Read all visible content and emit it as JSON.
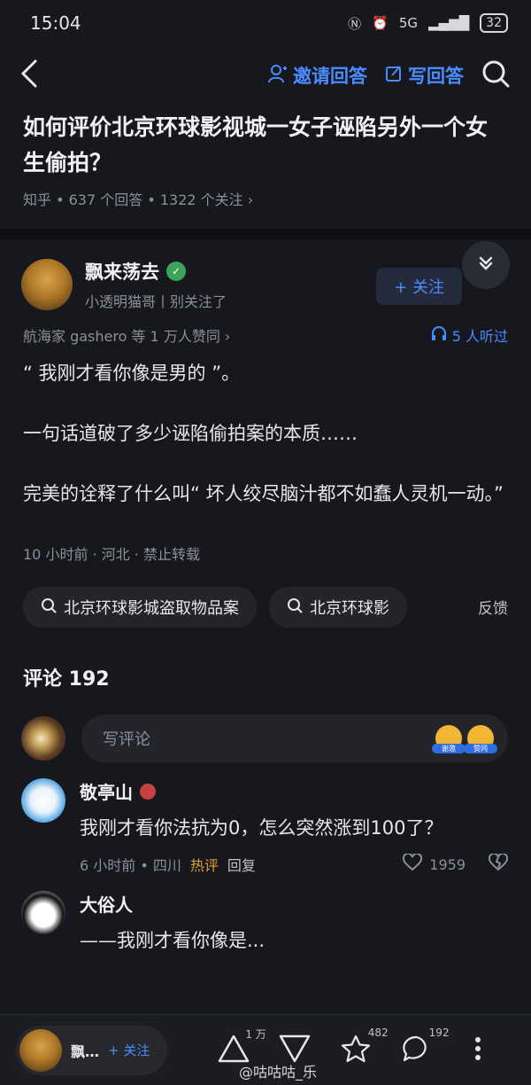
{
  "status_bar": {
    "time": "15:04",
    "network": "5G",
    "battery": "32"
  },
  "nav": {
    "invite": "邀请回答",
    "write": "写回答"
  },
  "question": {
    "title": "如何评价北京环球影视城一女子诬陷另外一个女生偷拍？",
    "meta": "知乎 • 637 个回答 • 1322 个关注 ›"
  },
  "author": {
    "name": "飘来荡去",
    "bio": "小透明猫哥丨别关注了",
    "follow_label": "+ 关注"
  },
  "upvotes": {
    "text": "航海家 gashero 等 1 万人赞同 ›",
    "listen": "5 人听过"
  },
  "answer": {
    "p1": "“ 我刚才看你像是男的 ”。",
    "p2": "一句话道破了多少诬陷偷拍案的本质……",
    "p3": "完美的诠释了什么叫“ 坏人绞尽脑汁都不如蠢人灵机一动。”",
    "meta": "10 小时前 · 河北 · 禁止转载"
  },
  "tags": [
    "北京环球影城盗取物品案",
    "北京环球影"
  ],
  "feedback": "反馈",
  "comments": {
    "heading": "评论 192",
    "placeholder": "写评论",
    "emoji_labels": [
      "谢邀",
      "赞同"
    ],
    "items": [
      {
        "name": "敬亭山",
        "text": "我刚才看你法抗为0，怎么突然涨到100了？",
        "time_location": "6 小时前 • 四川",
        "hot": "热评",
        "reply": "回复",
        "likes": "1959"
      },
      {
        "name": "大俗人",
        "text": "——我刚才看你像是..."
      }
    ]
  },
  "bottom_bar": {
    "author_short": "飘…",
    "follow": "+ 关注",
    "upvote_count": "1 万",
    "favorite_count": "482",
    "comment_count": "192"
  },
  "watermark": "@咕咕咕_乐",
  "colors": {
    "accent": "#4a8cff",
    "background": "#17181d",
    "hot": "#e0a030"
  }
}
